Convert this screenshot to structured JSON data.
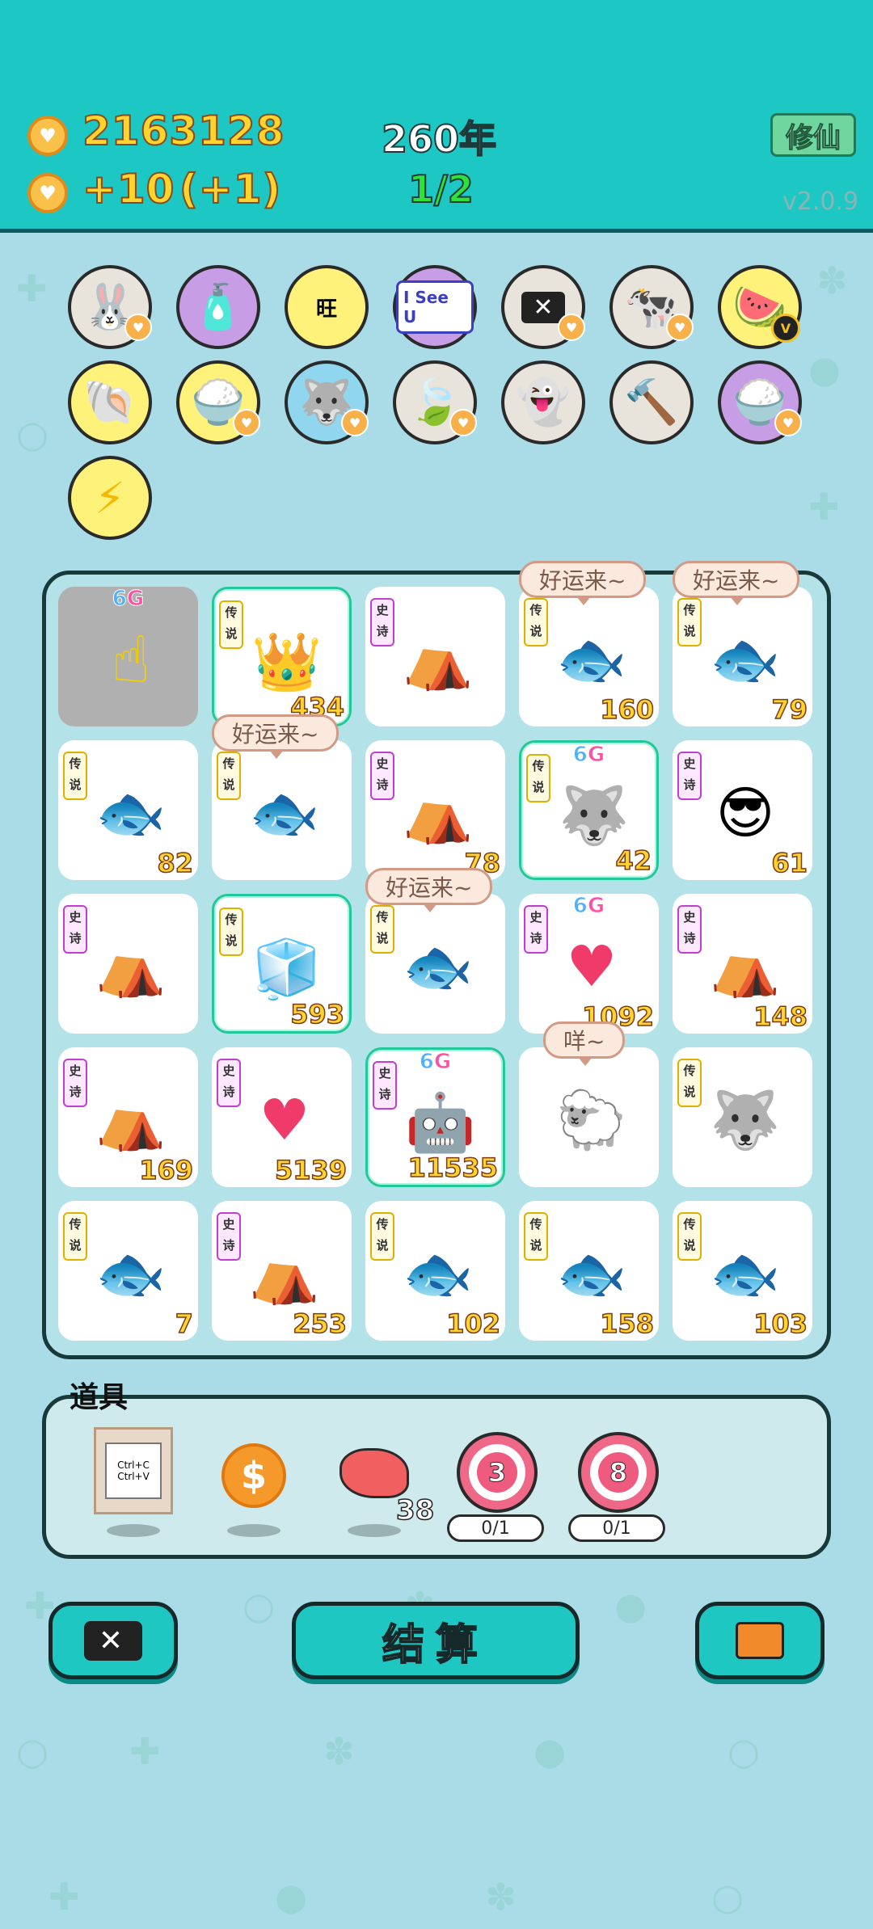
{
  "header": {
    "coins": "2163128",
    "income": "+10",
    "income_bonus": "(+1)",
    "year": "260年",
    "round": "1/2",
    "cultivate_label": "修仙",
    "version": "v2.0.9"
  },
  "inventory": {
    "iseeu_label": "I See U",
    "wang_char": "旺"
  },
  "board": {
    "tag_legend": "传说",
    "tag_epic": "史诗",
    "six_g_6": "6",
    "six_g_G": "G",
    "bubble_luck": "好运来~",
    "bubble_sheep": "咩~",
    "cells": [
      {
        "num": "",
        "label": ""
      },
      {
        "num": "434"
      },
      {
        "num": ""
      },
      {
        "num": "160"
      },
      {
        "num": "79"
      },
      {
        "num": "82"
      },
      {
        "num": ""
      },
      {
        "num": "78"
      },
      {
        "num": "42"
      },
      {
        "num": "61"
      },
      {
        "num": ""
      },
      {
        "num": "593"
      },
      {
        "num": ""
      },
      {
        "num": "1092"
      },
      {
        "num": "148"
      },
      {
        "num": "169"
      },
      {
        "num": "5139"
      },
      {
        "num": "11535"
      },
      {
        "num": ""
      },
      {
        "num": ""
      },
      {
        "num": "7"
      },
      {
        "num": "253"
      },
      {
        "num": "102"
      },
      {
        "num": "158"
      },
      {
        "num": "103"
      }
    ]
  },
  "props": {
    "title": "道具",
    "copy_text": "Ctrl+C Ctrl+V",
    "liver_qty": "38",
    "target1_value": "3",
    "target1_count": "0/1",
    "target2_value": "8",
    "target2_count": "0/1"
  },
  "actions": {
    "settle_label": "结算"
  },
  "colors": {
    "topbar": "#1dc7c3",
    "background": "#a9dce6",
    "gold_text": "#ffd42e"
  }
}
